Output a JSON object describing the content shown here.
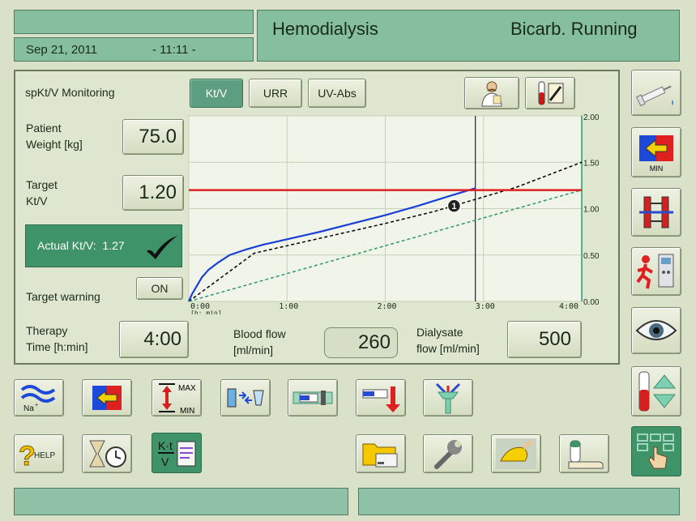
{
  "header": {
    "date": "Sep 21, 2011",
    "time": "- 11:11 -",
    "mode": "Hemodialysis",
    "status": "Bicarb. Running"
  },
  "panel": {
    "title": "spKt/V Monitoring",
    "tabs": [
      {
        "label": "Kt/V",
        "active": true
      },
      {
        "label": "URR",
        "active": false
      },
      {
        "label": "UV-Abs",
        "active": false
      }
    ],
    "patient_weight_label1": "Patient",
    "patient_weight_label2": "Weight [kg]",
    "patient_weight_value": "75.0",
    "target_ktv_label1": "Target",
    "target_ktv_label2": "Kt/V",
    "target_ktv_value": "1.20",
    "actual_ktv": "Actual Kt/V:  1.27",
    "target_warning_label": "Target warning",
    "target_warning_value": "ON",
    "therapy_time_label1": "Therapy",
    "therapy_time_label2": "Time [h:min]",
    "therapy_time_value": "4:00",
    "blood_flow_label1": "Blood flow",
    "blood_flow_label2": "[ml/min]",
    "blood_flow_value": "260",
    "dialysate_flow_label1": "Dialysate",
    "dialysate_flow_label2": "flow [ml/min]",
    "dialysate_flow_value": "500"
  },
  "chart_data": {
    "type": "line",
    "x_unit_label": "[h: min]",
    "x_ticks": [
      "0:00",
      "1:00",
      "2:00",
      "3:00",
      "4:00"
    ],
    "y_ticks": [
      "2.00",
      "1.50",
      "1.00",
      "0.50",
      "0.00"
    ],
    "xlim": [
      0,
      240
    ],
    "ylim": [
      0,
      2.0
    ],
    "current_time_min": 175,
    "target_line": 1.2,
    "marker_label": "1",
    "marker_point": {
      "x": 162,
      "y": 1.03
    },
    "series": [
      {
        "x": [
          0,
          2,
          5,
          8,
          12,
          18,
          25,
          35,
          45,
          60,
          80,
          100,
          120,
          140,
          160,
          175
        ],
        "y": [
          0,
          0.08,
          0.17,
          0.26,
          0.34,
          0.42,
          0.5,
          0.56,
          0.61,
          0.67,
          0.75,
          0.84,
          0.93,
          1.03,
          1.14,
          1.22
        ],
        "color": "#1a3fd6",
        "style": "solid"
      },
      {
        "x": [
          0,
          40,
          60,
          90,
          120,
          150,
          175,
          200,
          240
        ],
        "y": [
          0,
          0.52,
          0.6,
          0.72,
          0.84,
          0.97,
          1.1,
          1.23,
          1.5
        ],
        "color": "#000000",
        "style": "dashed"
      },
      {
        "x": [
          0,
          240
        ],
        "y": [
          0,
          1.2
        ],
        "color": "#2e9a6e",
        "style": "dashed"
      }
    ]
  },
  "colors": {
    "background": "#d9e2c8",
    "header_panel": "#86bfa0",
    "active_tab": "#5e9e80",
    "target_line": "#e02020",
    "actual_line": "#1a3fd6"
  },
  "side_buttons": [
    "syringe-icon",
    "min-uf-icon",
    "bloodline-clamp-icon",
    "emergency-exit-icon",
    "eye-icon",
    "level-adjust-icon",
    "touch-menu-icon"
  ],
  "bottom_row1": [
    "sodium-profile-icon",
    "uf-profile-icon",
    "max-min-limits-icon",
    "filter-change-icon",
    "heparin-pump-icon",
    "bolus-infusion-icon",
    "connector-icon"
  ],
  "bottom_row2_help": "HELP",
  "bottom_row2": [
    "timer-clock-icon",
    "ktv-icon",
    "folder-card-icon",
    "wrench-icon",
    "cleaning-icon",
    "dialyzer-disinfect-icon"
  ]
}
